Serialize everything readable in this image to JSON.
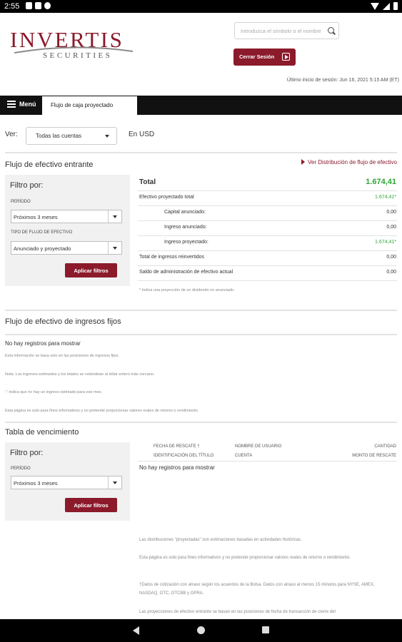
{
  "status_bar": {
    "time": "2:55"
  },
  "header": {
    "logo_top": "INVERTIS",
    "logo_bottom": "SECURITIES",
    "search_placeholder": "Introduzca el símbolo o el nombre",
    "logout_label": "Cerrar Sesión",
    "last_login": "Último inicio de sesión: Jun 16, 2021 5:15 AM (ET)"
  },
  "menu": {
    "menu_label": "Menú",
    "active_tab": "Flujo de caja proyectado"
  },
  "view": {
    "label": "Ver:",
    "selected": "Todas las cuentas",
    "currency": "En USD"
  },
  "incoming": {
    "title": "Flujo de efectivo entrante",
    "link": "Ver Distribución de flujo de efectivo",
    "filter": {
      "title": "Filtro por:",
      "period_label": "PERÍODO",
      "period_value": "Próximos 3 meses",
      "type_label": "TIPO DE FLUJO DE EFECTIVO",
      "type_value": "Anunciado y proyectado",
      "apply": "Aplicar filtros"
    },
    "total_label": "Total",
    "total_value": "1.674,41",
    "rows": [
      {
        "label": "Efectivo proyectado total",
        "value": "1.674,41*"
      },
      {
        "label": "Capital anunciado:",
        "value": "0,00"
      },
      {
        "label": "Ingreso anunciado:",
        "value": "0,00"
      },
      {
        "label": "Ingreso proyectado:",
        "value": "1.674,41*"
      },
      {
        "label": "Total de ingresos reinvertidos",
        "value": "0,00"
      },
      {
        "label": "Saldo de administración de efectivo actual",
        "value": "0,00"
      }
    ],
    "footnote": "* Indica una proyección de un dividendo no anunciado."
  },
  "fixed_income": {
    "title": "Flujo de efectivo de ingresos fijos",
    "empty": "No hay registros para mostrar",
    "notes": [
      "Esta información se basa solo en las posiciones de ingresos fijos.",
      "Nota: Los ingresos estimados y los totales se redondean al dólar entero más cercano.",
      "'-' indica que no hay un ingreso estimado para ese mes.",
      "Esta página es solo para fines informativos y no pretende proporcionar valores reales de retorno o rendimiento."
    ]
  },
  "maturity": {
    "title": "Tabla de vencimiento",
    "filter": {
      "title": "Filtro por:",
      "period_label": "PERÍODO",
      "period_value": "Próximos 3 meses",
      "apply": "Aplicar filtros"
    },
    "headers_row1": [
      "FECHA DE RESCATE †",
      "NOMBRE DE USUARIO",
      "CANTIDAD"
    ],
    "headers_row2": [
      "IDENTIFICACIÓN DEL TÍTULO",
      "CUENTA",
      "MONTO DE RESCATE"
    ],
    "empty": "No hay registros para mostrar"
  },
  "footnotes": [
    "Las distribuciones \"proyectadas\" son estimaciones basadas en actividades históricas.",
    "Esta página es solo para fines informativos y no pretende proporcionar valores reales de retorno o rendimiento.",
    "†Datos de cotización con atraso según los acuerdos de la Bolsa. Datos con atraso al menos 15 minutos para NYSE, AMEX, NASDAQ, OTC, OTCBB y OPRA.",
    "Las proyecciones de efectivo entrante se basan en las posiciones de fecha de transacción de cierre del"
  ]
}
